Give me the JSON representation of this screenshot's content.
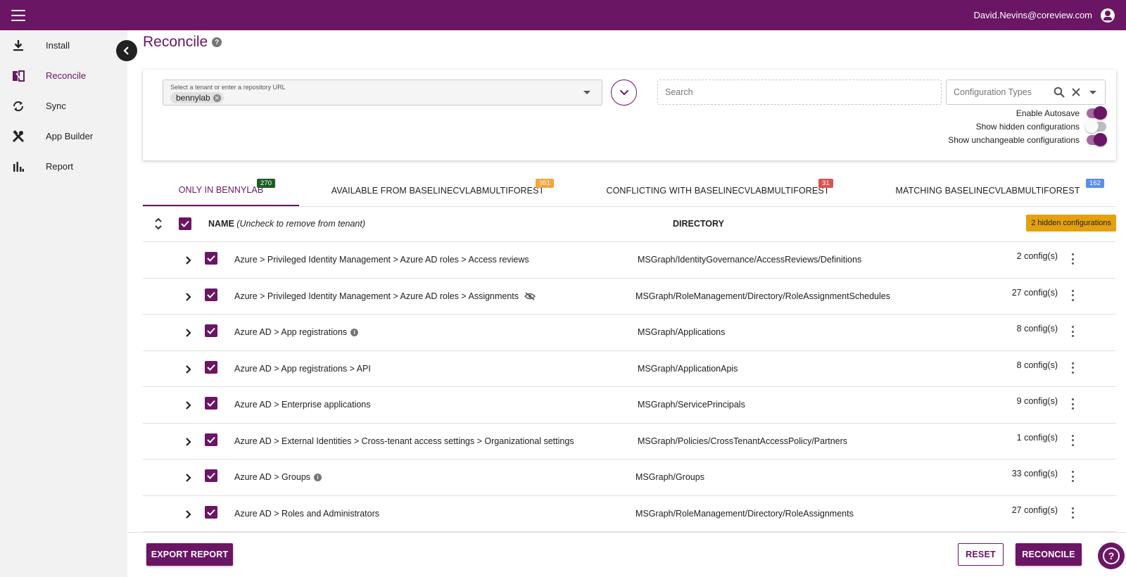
{
  "header": {
    "user_email": "David.Nevins@coreview.com"
  },
  "sidebar": {
    "items": [
      {
        "label": "Install",
        "icon": "download-icon"
      },
      {
        "label": "Reconcile",
        "icon": "reconcile-icon",
        "active": true
      },
      {
        "label": "Sync",
        "icon": "sync-icon"
      },
      {
        "label": "App Builder",
        "icon": "tools-icon"
      },
      {
        "label": "Report",
        "icon": "report-icon"
      }
    ]
  },
  "page": {
    "title": "Reconcile",
    "help": "?"
  },
  "filters": {
    "tenant_label": "Select a tenant or enter a repository URL",
    "tenant_value": "bennylab",
    "search_placeholder": "Search",
    "config_types_placeholder": "Configuration Types",
    "toggles": [
      {
        "label": "Enable Autosave",
        "on": true
      },
      {
        "label": "Show hidden configurations",
        "on": false
      },
      {
        "label": "Show unchangeable configurations",
        "on": true
      }
    ]
  },
  "tabs": [
    {
      "label": "ONLY IN BENNYLAB",
      "badge": "270",
      "badge_color": "#1b5e20",
      "active": true
    },
    {
      "label": "AVAILABLE FROM BASELINECVLABMULTIFOREST",
      "badge": "351",
      "badge_color": "#f6a43c",
      "active": false
    },
    {
      "label": "CONFLICTING WITH BASELINECVLABMULTIFOREST",
      "badge": "31",
      "badge_color": "#d9534f",
      "active": false
    },
    {
      "label": "MATCHING BASELINECVLABMULTIFOREST",
      "badge": "162",
      "badge_color": "#5b8def",
      "active": false
    }
  ],
  "table": {
    "name_header": "NAME",
    "name_header_note": "(Uncheck to remove from tenant)",
    "directory_header": "DIRECTORY",
    "hidden_badge": "2 hidden configurations",
    "rows": [
      {
        "name": "Azure > Privileged Identity Management > Azure AD roles > Access reviews",
        "directory": "MSGraph/IdentityGovernance/AccessReviews/Definitions",
        "count": "2 config(s)",
        "suffix_icon": ""
      },
      {
        "name": "Azure > Privileged Identity Management > Azure AD roles > Assignments",
        "directory": "MSGraph/RoleManagement/Directory/RoleAssignmentSchedules",
        "count": "27 config(s)",
        "suffix_icon": "eye-off-icon"
      },
      {
        "name": "Azure AD > App registrations",
        "directory": "MSGraph/Applications",
        "count": "8 config(s)",
        "suffix_icon": "info-icon"
      },
      {
        "name": "Azure AD > App registrations > API",
        "directory": "MSGraph/ApplicationApis",
        "count": "8 config(s)",
        "suffix_icon": ""
      },
      {
        "name": "Azure AD > Enterprise applications",
        "directory": "MSGraph/ServicePrincipals",
        "count": "9 config(s)",
        "suffix_icon": ""
      },
      {
        "name": "Azure AD > External Identities > Cross-tenant access settings > Organizational settings",
        "directory": "MSGraph/Policies/CrossTenantAccessPolicy/Partners",
        "count": "1 config(s)",
        "suffix_icon": ""
      },
      {
        "name": "Azure AD > Groups",
        "directory": "MSGraph/Groups",
        "count": "33 config(s)",
        "suffix_icon": "info-icon"
      },
      {
        "name": "Azure AD > Roles and Administrators",
        "directory": "MSGraph/RoleManagement/Directory/RoleAssignments",
        "count": "27 config(s)",
        "suffix_icon": ""
      }
    ]
  },
  "footer": {
    "export_label": "EXPORT REPORT",
    "reset_label": "RESET",
    "reconcile_label": "RECONCILE",
    "help_label": "?"
  },
  "colors": {
    "brand": "#6b1565",
    "hidden_badge": "#e5a00d"
  }
}
